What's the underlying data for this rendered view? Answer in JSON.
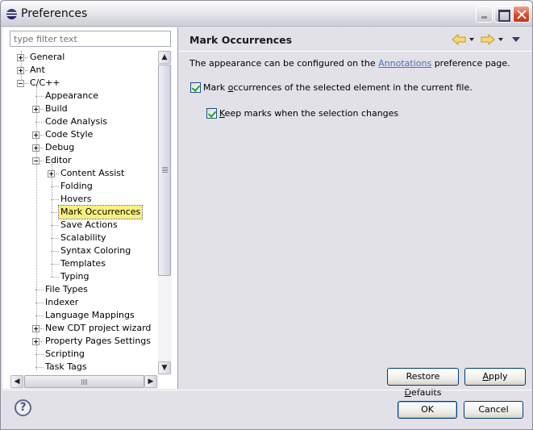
{
  "window": {
    "title": "Preferences",
    "controls": [
      "minimize",
      "maximize",
      "close"
    ]
  },
  "filter": {
    "placeholder": "type filter text",
    "value": ""
  },
  "tree": {
    "items": [
      {
        "label": "General",
        "level": 0,
        "expander": "plus"
      },
      {
        "label": "Ant",
        "level": 0,
        "expander": "plus"
      },
      {
        "label": "C/C++",
        "level": 0,
        "expander": "minus"
      },
      {
        "label": "Appearance",
        "level": 1,
        "expander": "none"
      },
      {
        "label": "Build",
        "level": 1,
        "expander": "plus"
      },
      {
        "label": "Code Analysis",
        "level": 1,
        "expander": "none"
      },
      {
        "label": "Code Style",
        "level": 1,
        "expander": "plus"
      },
      {
        "label": "Debug",
        "level": 1,
        "expander": "plus"
      },
      {
        "label": "Editor",
        "level": 1,
        "expander": "minus"
      },
      {
        "label": "Content Assist",
        "level": 2,
        "expander": "plus"
      },
      {
        "label": "Folding",
        "level": 2,
        "expander": "none"
      },
      {
        "label": "Hovers",
        "level": 2,
        "expander": "none"
      },
      {
        "label": "Mark Occurrences",
        "level": 2,
        "expander": "none",
        "selected": true
      },
      {
        "label": "Save Actions",
        "level": 2,
        "expander": "none"
      },
      {
        "label": "Scalability",
        "level": 2,
        "expander": "none"
      },
      {
        "label": "Syntax Coloring",
        "level": 2,
        "expander": "none"
      },
      {
        "label": "Templates",
        "level": 2,
        "expander": "none"
      },
      {
        "label": "Typing",
        "level": 2,
        "expander": "none"
      },
      {
        "label": "File Types",
        "level": 1,
        "expander": "none"
      },
      {
        "label": "Indexer",
        "level": 1,
        "expander": "none"
      },
      {
        "label": "Language Mappings",
        "level": 1,
        "expander": "none"
      },
      {
        "label": "New CDT project wizard",
        "level": 1,
        "expander": "plus"
      },
      {
        "label": "Property Pages Settings",
        "level": 1,
        "expander": "plus"
      },
      {
        "label": "Scripting",
        "level": 1,
        "expander": "none"
      },
      {
        "label": "Task Tags",
        "level": 1,
        "expander": "none"
      }
    ]
  },
  "page": {
    "title": "Mark Occurrences",
    "description_before": "The appearance can be configured on the ",
    "description_link": "Annotations",
    "description_after": " preference page.",
    "options": [
      {
        "label_pre": "Mark ",
        "label_mnemonic": "o",
        "label_post": "ccurrences of the selected element in the current file.",
        "checked": true
      },
      {
        "label_pre": "",
        "label_mnemonic": "K",
        "label_post": "eep marks when the selection changes",
        "checked": true
      }
    ],
    "restore_defaults": {
      "pre": "Restore ",
      "mnemonic": "D",
      "post": "efaults"
    },
    "apply": {
      "pre": "",
      "mnemonic": "A",
      "post": "pply"
    }
  },
  "nav": {
    "back_icon": "back-arrow",
    "forward_icon": "forward-arrow",
    "menu_icon": "view-menu"
  },
  "footer": {
    "help_glyph": "?",
    "ok_label": "OK",
    "cancel_label": "Cancel"
  },
  "colors": {
    "selection": "#f8f07e",
    "link": "#4b73b8",
    "check": "#21a121"
  }
}
